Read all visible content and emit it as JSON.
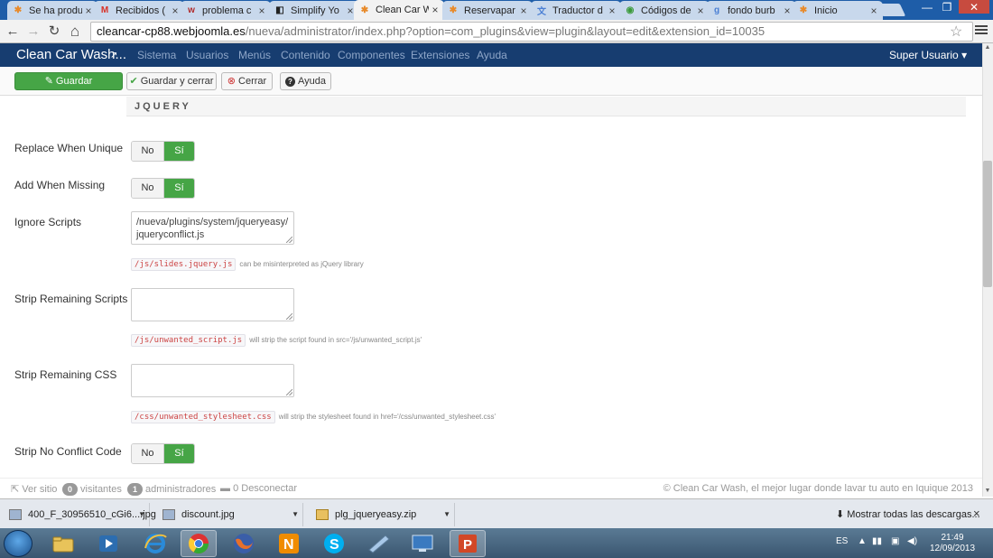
{
  "browser": {
    "tabs": [
      {
        "label": "Se ha produ",
        "icon": "joomla-icon",
        "color": "#e88a2a"
      },
      {
        "label": "Recibidos (",
        "icon": "gmail-icon",
        "color": "#d93025"
      },
      {
        "label": "problema c",
        "icon": "wamp-icon",
        "color": "#b02a2a"
      },
      {
        "label": "Simplify Yo",
        "icon": "simplify-icon",
        "color": "#222222"
      },
      {
        "label": "Clean Car W",
        "icon": "joomla-icon",
        "color": "#e88a2a",
        "active": true
      },
      {
        "label": "Reservapar",
        "icon": "joomla-icon",
        "color": "#e88a2a"
      },
      {
        "label": "Traductor d",
        "icon": "translate-icon",
        "color": "#4a7fd4"
      },
      {
        "label": "Códigos de",
        "icon": "chrome-icon",
        "color": "#3a9a3a"
      },
      {
        "label": "fondo burb",
        "icon": "google-icon",
        "color": "#4a7fd4"
      },
      {
        "label": "Inicio",
        "icon": "joomla-icon",
        "color": "#e88a2a"
      }
    ],
    "tab_close": "×",
    "url_domain": "cleancar-cp88.webjoomla.es",
    "url_path": "/nueva/administrator/index.php?option=com_plugins&view=plugin&layout=edit&extension_id=10035",
    "window_controls": [
      "—",
      "❐",
      "✕"
    ],
    "nav_glyphs": {
      "back": "←",
      "forward": "→",
      "reload": "↻",
      "home": "⌂",
      "star": "☆"
    }
  },
  "navbar": {
    "brand": "Clean Car Wash...",
    "brand_icon": "↗",
    "menu": [
      "Sistema",
      "Usuarios",
      "Menús",
      "Contenido",
      "Componentes",
      "Extensiones",
      "Ayuda"
    ],
    "user": "Super Usuario",
    "user_caret": "▾"
  },
  "toolbar": {
    "save": "Guardar",
    "save_close": "Guardar y cerrar",
    "close": "Cerrar",
    "help": "Ayuda",
    "icons": {
      "save": "✎",
      "save_close": "✔",
      "close": "⊗",
      "help": "?"
    }
  },
  "section_title": "JQUERY",
  "fields": {
    "replace_when_unique": {
      "label": "Replace When Unique",
      "no": "No",
      "yes": "Sí"
    },
    "add_when_missing": {
      "label": "Add When Missing",
      "no": "No",
      "yes": "Sí"
    },
    "ignore_scripts": {
      "label": "Ignore Scripts",
      "value": "/nueva/plugins/system/jqueryeasy/jqueryconflict.js",
      "hint_code": "/js/slides.jquery.js",
      "hint_text": "can be misinterpreted as jQuery library"
    },
    "strip_remaining_scripts": {
      "label": "Strip Remaining Scripts",
      "value": "",
      "hint_code": "/js/unwanted_script.js",
      "hint_text": "will strip the script found in src='/js/unwanted_script.js'"
    },
    "strip_remaining_css": {
      "label": "Strip Remaining CSS",
      "value": "",
      "hint_code": "/css/unwanted_stylesheet.css",
      "hint_text": "will strip the stylesheet found in href='/css/unwanted_stylesheet.css'"
    },
    "strip_no_conflict": {
      "label": "Strip No Conflict Code",
      "no": "No",
      "yes": "Sí"
    }
  },
  "footer": {
    "view_site": "Ver sitio",
    "visitors_count": "0",
    "visitors": "visitantes",
    "admins_count": "1",
    "admins": "administradores",
    "disconnect_count": "0",
    "disconnect": "Desconectar",
    "copyright": "© Clean Car Wash, el mejor lugar donde lavar tu auto en Iquique 2013"
  },
  "downloads": {
    "items": [
      "400_F_30956510_cGi6....jpg",
      "discount.jpg",
      "plg_jqueryeasy.zip"
    ],
    "show_all": "Mostrar todas las descargas...",
    "close": "×"
  },
  "taskbar": {
    "lang": "ES",
    "time": "21:49",
    "date": "12/09/2013"
  }
}
